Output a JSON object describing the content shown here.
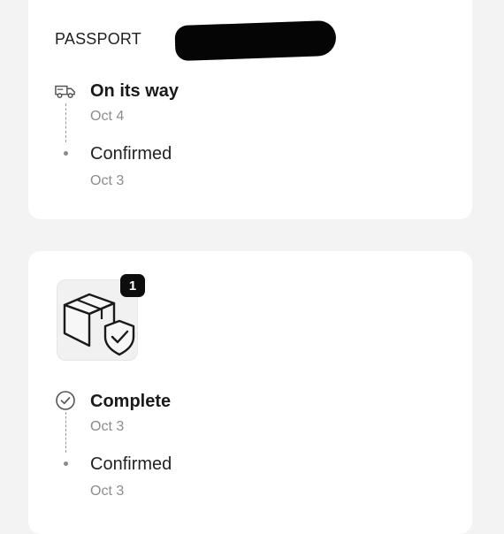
{
  "shipment_card": {
    "tracking_label": "PASSPORT",
    "steps": [
      {
        "title": "On its way",
        "date": "Oct 4",
        "icon": "delivery-truck-icon"
      },
      {
        "title": "Confirmed",
        "date": "Oct 3",
        "icon": "dot-icon"
      }
    ]
  },
  "order_card": {
    "item_quantity": "1",
    "item_icon": "box-with-shield-icon",
    "steps": [
      {
        "title": "Complete",
        "date": "Oct 3",
        "icon": "check-circle-icon"
      },
      {
        "title": "Confirmed",
        "date": "Oct 3",
        "icon": "dot-icon"
      }
    ]
  }
}
